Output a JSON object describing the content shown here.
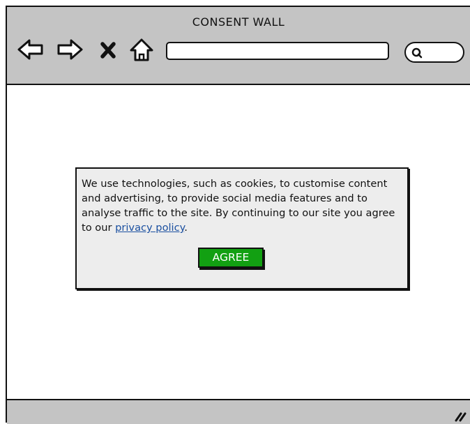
{
  "window": {
    "title": "CONSENT WALL"
  },
  "toolbar": {
    "icons": [
      "back-arrow-icon",
      "forward-arrow-icon",
      "close-icon",
      "home-icon",
      "search-icon"
    ],
    "address_value": "",
    "search_value": ""
  },
  "dialog": {
    "message": "We use technologies, such as cookies, to customise content and advertising, to provide social media features and to analyse traffic to the site. By continuing to our site you agree to our ",
    "link_label": "privacy policy",
    "link_suffix": ".",
    "button_label": "AGREE"
  },
  "colors": {
    "chrome": "#c4c4c4",
    "dialog_bg": "#ededed",
    "button_bg": "#12a012",
    "link": "#1a4fa0"
  }
}
